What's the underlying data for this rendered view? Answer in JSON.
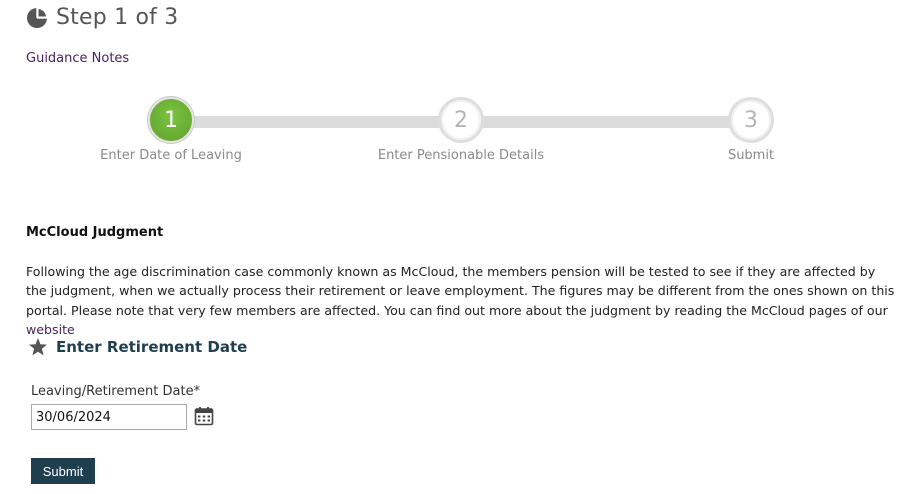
{
  "header": {
    "title": "Step 1 of 3",
    "icon": "pie-chart-icon"
  },
  "guidance": {
    "label": "Guidance Notes"
  },
  "stepper": {
    "active_color": "#6aaf35",
    "steps": [
      {
        "number": "1",
        "label": "Enter Date of Leaving",
        "state": "active"
      },
      {
        "number": "2",
        "label": "Enter Pensionable Details",
        "state": "inactive"
      },
      {
        "number": "3",
        "label": "Submit",
        "state": "inactive"
      }
    ]
  },
  "notice": {
    "heading": "McCloud Judgment",
    "body": "Following the age discrimination case commonly known as McCloud, the members pension will be tested to see if they are affected by the judgment, when we actually process their retirement or leave employment. The figures may be different from the ones shown on this portal. Please note that very few members are affected. You can find out more about the judgment by reading the McCloud pages of our ",
    "link_label": "website"
  },
  "form": {
    "section_title": "Enter Retirement Date",
    "section_icon": "star-icon",
    "date_label": "Leaving/Retirement Date*",
    "date_value": "30/06/2024",
    "calendar_icon": "calendar-icon",
    "submit_label": "Submit",
    "primary_color": "#1f3f4f"
  }
}
